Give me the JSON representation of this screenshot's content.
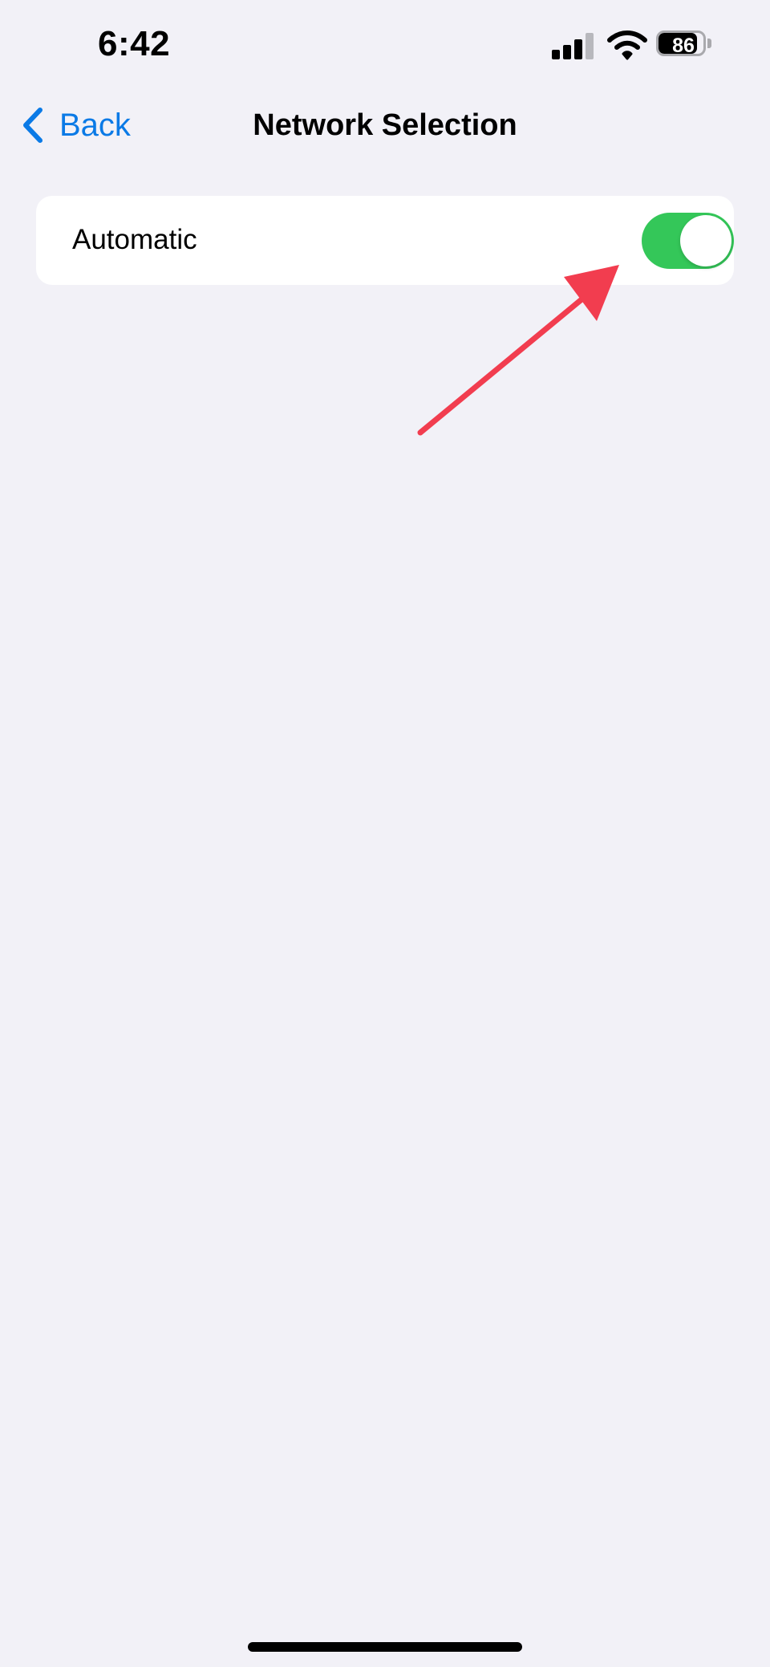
{
  "status_bar": {
    "time": "6:42",
    "battery_level": "86",
    "battery_fraction": 0.86,
    "icons": [
      "cellular-signal-icon",
      "wifi-icon",
      "battery-icon"
    ]
  },
  "nav": {
    "back_label": "Back",
    "title": "Network Selection",
    "back_icon": "chevron-left-icon"
  },
  "settings": {
    "automatic_label": "Automatic",
    "automatic_enabled": true
  },
  "colors": {
    "background": "#f2f1f7",
    "accent": "#0b7ae6",
    "toggle_on": "#34c759",
    "annotation": "#f23d4f"
  }
}
